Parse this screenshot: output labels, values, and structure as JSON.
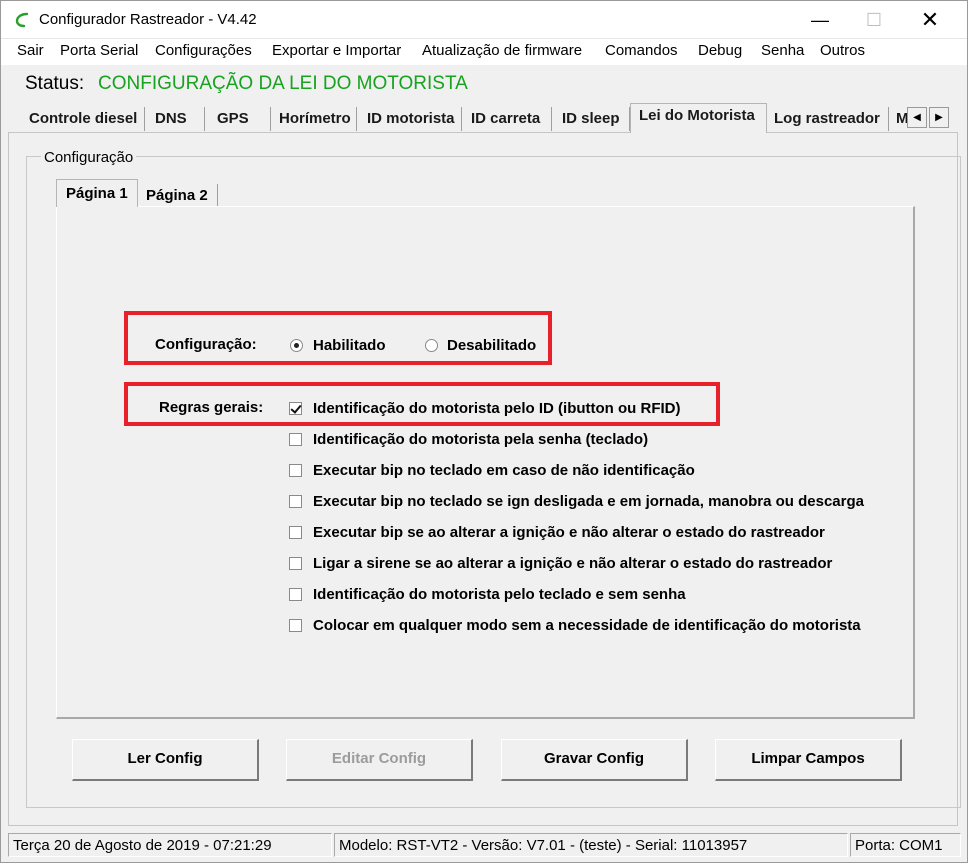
{
  "window": {
    "title": "Configurador Rastreador - V4.42",
    "minimize": "—",
    "maximize": "☐",
    "close": "✕"
  },
  "menu": [
    "Sair",
    "Porta Serial",
    "Configurações",
    "Exportar e Importar",
    "Atualização de firmware",
    "Comandos",
    "Debug",
    "Senha",
    "Outros"
  ],
  "status": {
    "label": "Status:",
    "value": "CONFIGURAÇÃO DA LEI DO MOTORISTA",
    "value_color": "#17a31f"
  },
  "tabs": [
    "Controle diesel",
    "DNS",
    "GPS",
    "Horímetro",
    "ID motorista",
    "ID carreta",
    "ID sleep",
    "Lei do Motorista",
    "Log rastreador",
    "M"
  ],
  "active_tab": "Lei do Motorista",
  "tab_scroll": {
    "left": "◀",
    "right": "▶"
  },
  "group": {
    "title": "Configuração"
  },
  "subtabs": [
    "Página 1",
    "Página 2"
  ],
  "config": {
    "label": "Configuração:",
    "options": [
      {
        "label": "Habilitado",
        "selected": true
      },
      {
        "label": "Desabilitado",
        "selected": false
      }
    ]
  },
  "rules": {
    "label": "Regras gerais:",
    "items": [
      {
        "label": "Identificação do motorista pelo ID (ibutton ou RFID)",
        "checked": true
      },
      {
        "label": "Identificação do motorista pela senha (teclado)",
        "checked": false
      },
      {
        "label": "Executar bip no teclado em caso de não identificação",
        "checked": false
      },
      {
        "label": "Executar bip no teclado se ign desligada e em jornada, manobra ou descarga",
        "checked": false
      },
      {
        "label": "Executar bip se ao alterar a ignição e não alterar o estado do rastreador",
        "checked": false
      },
      {
        "label": "Ligar a sirene se ao alterar a ignição e não alterar o estado do rastreador",
        "checked": false
      },
      {
        "label": "Identificação do motorista pelo teclado e sem senha",
        "checked": false
      },
      {
        "label": "Colocar em qualquer modo sem a necessidade de identificação do motorista",
        "checked": false
      }
    ]
  },
  "buttons": {
    "read": "Ler Config",
    "edit": "Editar Config",
    "save": "Gravar Config",
    "clear": "Limpar Campos"
  },
  "statusbar": {
    "datetime": "Terça 20 de Agosto de 2019  -  07:21:29",
    "device": "Modelo: RST-VT2  -  Versão: V7.01 - (teste)  -  Serial: 11013957",
    "port": "Porta: COM1"
  },
  "highlight_color": "#e8202a"
}
